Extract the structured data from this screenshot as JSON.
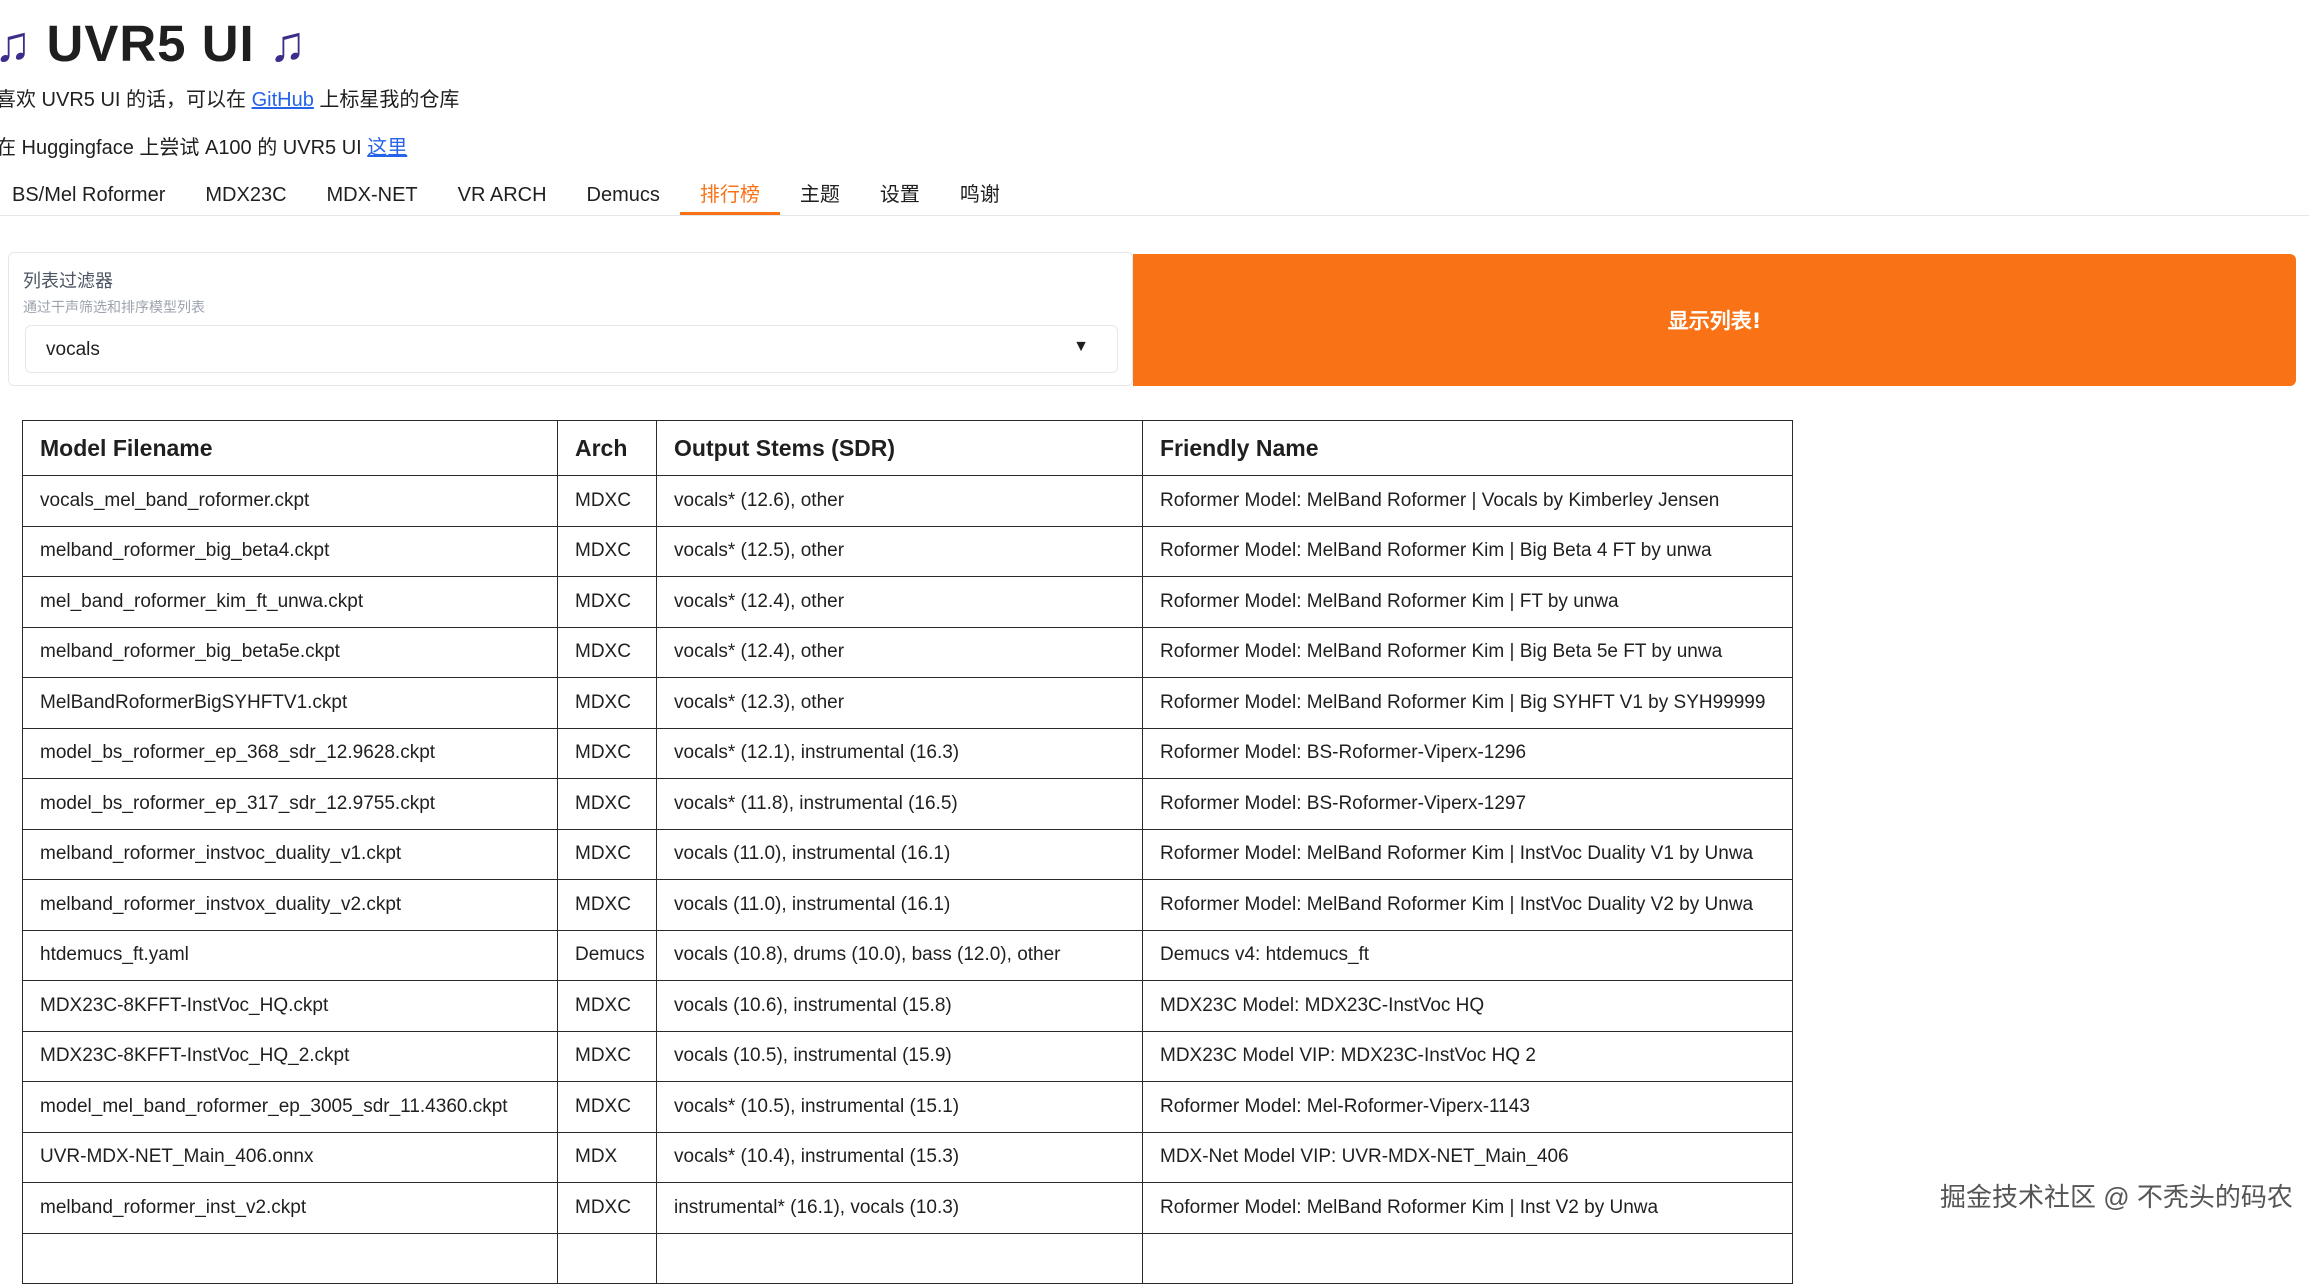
{
  "header": {
    "title": "UVR5 UI",
    "icon": "musical-note-icon",
    "line1_text": "喜欢 UVR5 UI 的话，可以在",
    "line1_link": "GitHub",
    "line1_suffix": "上标星我的仓库",
    "line2_text": "在 Huggingface 上尝试 A100 的 UVR5 UI",
    "line2_link": "这里"
  },
  "tabs": [
    {
      "label": "BS/Mel Roformer"
    },
    {
      "label": "MDX23C"
    },
    {
      "label": "MDX-NET"
    },
    {
      "label": "VR ARCH"
    },
    {
      "label": "Demucs"
    },
    {
      "label": "排行榜"
    },
    {
      "label": "主题"
    },
    {
      "label": "设置"
    },
    {
      "label": "鸣谢"
    }
  ],
  "active_tab": "排行榜",
  "filter": {
    "label": "列表过滤器",
    "info": "通过干声筛选和排序模型列表",
    "selected": "vocals"
  },
  "show_button": "显示列表!",
  "table": {
    "headers": [
      "Model Filename",
      "Arch",
      "Output Stems (SDR)",
      "Friendly Name"
    ],
    "rows": [
      [
        "vocals_mel_band_roformer.ckpt",
        "MDXC",
        "vocals* (12.6), other",
        "Roformer Model: MelBand Roformer | Vocals by Kimberley Jensen"
      ],
      [
        "melband_roformer_big_beta4.ckpt",
        "MDXC",
        "vocals* (12.5), other",
        "Roformer Model: MelBand Roformer Kim | Big Beta 4 FT by unwa"
      ],
      [
        "mel_band_roformer_kim_ft_unwa.ckpt",
        "MDXC",
        "vocals* (12.4), other",
        "Roformer Model: MelBand Roformer Kim | FT by unwa"
      ],
      [
        "melband_roformer_big_beta5e.ckpt",
        "MDXC",
        "vocals* (12.4), other",
        "Roformer Model: MelBand Roformer Kim | Big Beta 5e FT by unwa"
      ],
      [
        "MelBandRoformerBigSYHFTV1.ckpt",
        "MDXC",
        "vocals* (12.3), other",
        "Roformer Model: MelBand Roformer Kim | Big SYHFT V1 by SYH99999"
      ],
      [
        "model_bs_roformer_ep_368_sdr_12.9628.ckpt",
        "MDXC",
        "vocals* (12.1), instrumental (16.3)",
        "Roformer Model: BS-Roformer-Viperx-1296"
      ],
      [
        "model_bs_roformer_ep_317_sdr_12.9755.ckpt",
        "MDXC",
        "vocals* (11.8), instrumental (16.5)",
        "Roformer Model: BS-Roformer-Viperx-1297"
      ],
      [
        "melband_roformer_instvoc_duality_v1.ckpt",
        "MDXC",
        "vocals (11.0), instrumental (16.1)",
        "Roformer Model: MelBand Roformer Kim | InstVoc Duality V1 by Unwa"
      ],
      [
        "melband_roformer_instvox_duality_v2.ckpt",
        "MDXC",
        "vocals (11.0), instrumental (16.1)",
        "Roformer Model: MelBand Roformer Kim | InstVoc Duality V2 by Unwa"
      ],
      [
        "htdemucs_ft.yaml",
        "Demucs",
        "vocals (10.8), drums (10.0), bass (12.0), other",
        "Demucs v4: htdemucs_ft"
      ],
      [
        "MDX23C-8KFFT-InstVoc_HQ.ckpt",
        "MDXC",
        "vocals (10.6), instrumental (15.8)",
        "MDX23C Model: MDX23C-InstVoc HQ"
      ],
      [
        "MDX23C-8KFFT-InstVoc_HQ_2.ckpt",
        "MDXC",
        "vocals (10.5), instrumental (15.9)",
        "MDX23C Model VIP: MDX23C-InstVoc HQ 2"
      ],
      [
        "model_mel_band_roformer_ep_3005_sdr_11.4360.ckpt",
        "MDXC",
        "vocals* (10.5), instrumental (15.1)",
        "Roformer Model: Mel-Roformer-Viperx-1143"
      ],
      [
        "UVR-MDX-NET_Main_406.onnx",
        "MDX",
        "vocals* (10.4), instrumental (15.3)",
        "MDX-Net Model VIP: UVR-MDX-NET_Main_406"
      ],
      [
        "melband_roformer_inst_v2.ckpt",
        "MDXC",
        "instrumental* (16.1), vocals (10.3)",
        "Roformer Model: MelBand Roformer Kim | Inst V2 by Unwa"
      ],
      [
        "",
        "",
        "",
        ""
      ]
    ]
  },
  "watermark": "掘金技术社区 @ 不秃头的码农"
}
